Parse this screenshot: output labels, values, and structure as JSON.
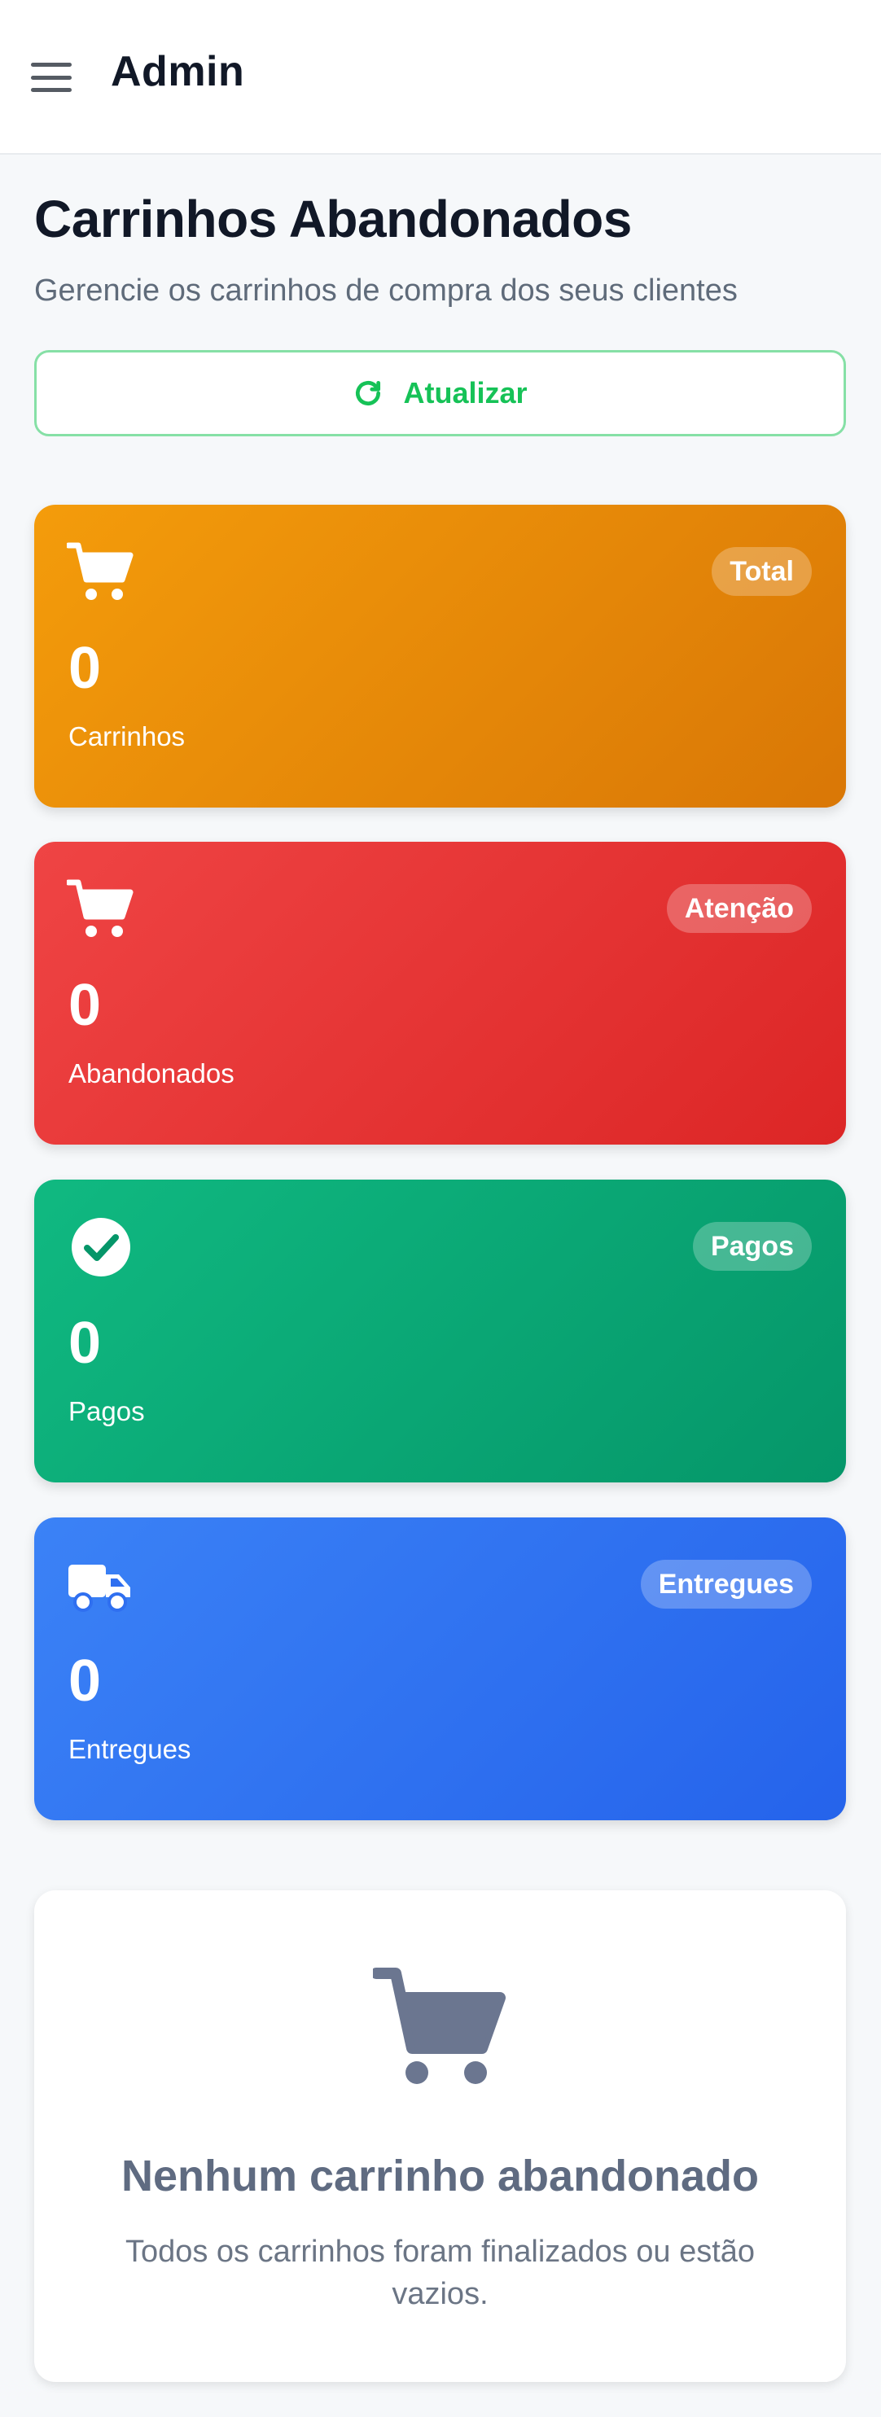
{
  "header": {
    "brand": "Admin",
    "menu_icon": "hamburger-menu-icon"
  },
  "page": {
    "title": "Carrinhos Abandonados",
    "subtitle": "Gerencie os carrinhos de compra dos seus clientes",
    "refresh_label": "Atualizar",
    "refresh_icon": "refresh-icon"
  },
  "colors": {
    "accent_green": "#16c257",
    "total": "#f49c0b",
    "abandoned": "#ef4444",
    "paid": "#10b981",
    "delivered": "#3b82f6"
  },
  "stats": [
    {
      "badge": "Total",
      "value": "0",
      "caption": "Carrinhos",
      "icon": "cart-icon"
    },
    {
      "badge": "Atenção",
      "value": "0",
      "caption": "Abandonados",
      "icon": "cart-icon"
    },
    {
      "badge": "Pagos",
      "value": "0",
      "caption": "Pagos",
      "icon": "check-circle-icon"
    },
    {
      "badge": "Entregues",
      "value": "0",
      "caption": "Entregues",
      "icon": "truck-icon"
    }
  ],
  "empty_state": {
    "icon": "cart-icon",
    "title": "Nenhum carrinho abandonado",
    "text": "Todos os carrinhos foram finalizados ou estão vazios."
  }
}
